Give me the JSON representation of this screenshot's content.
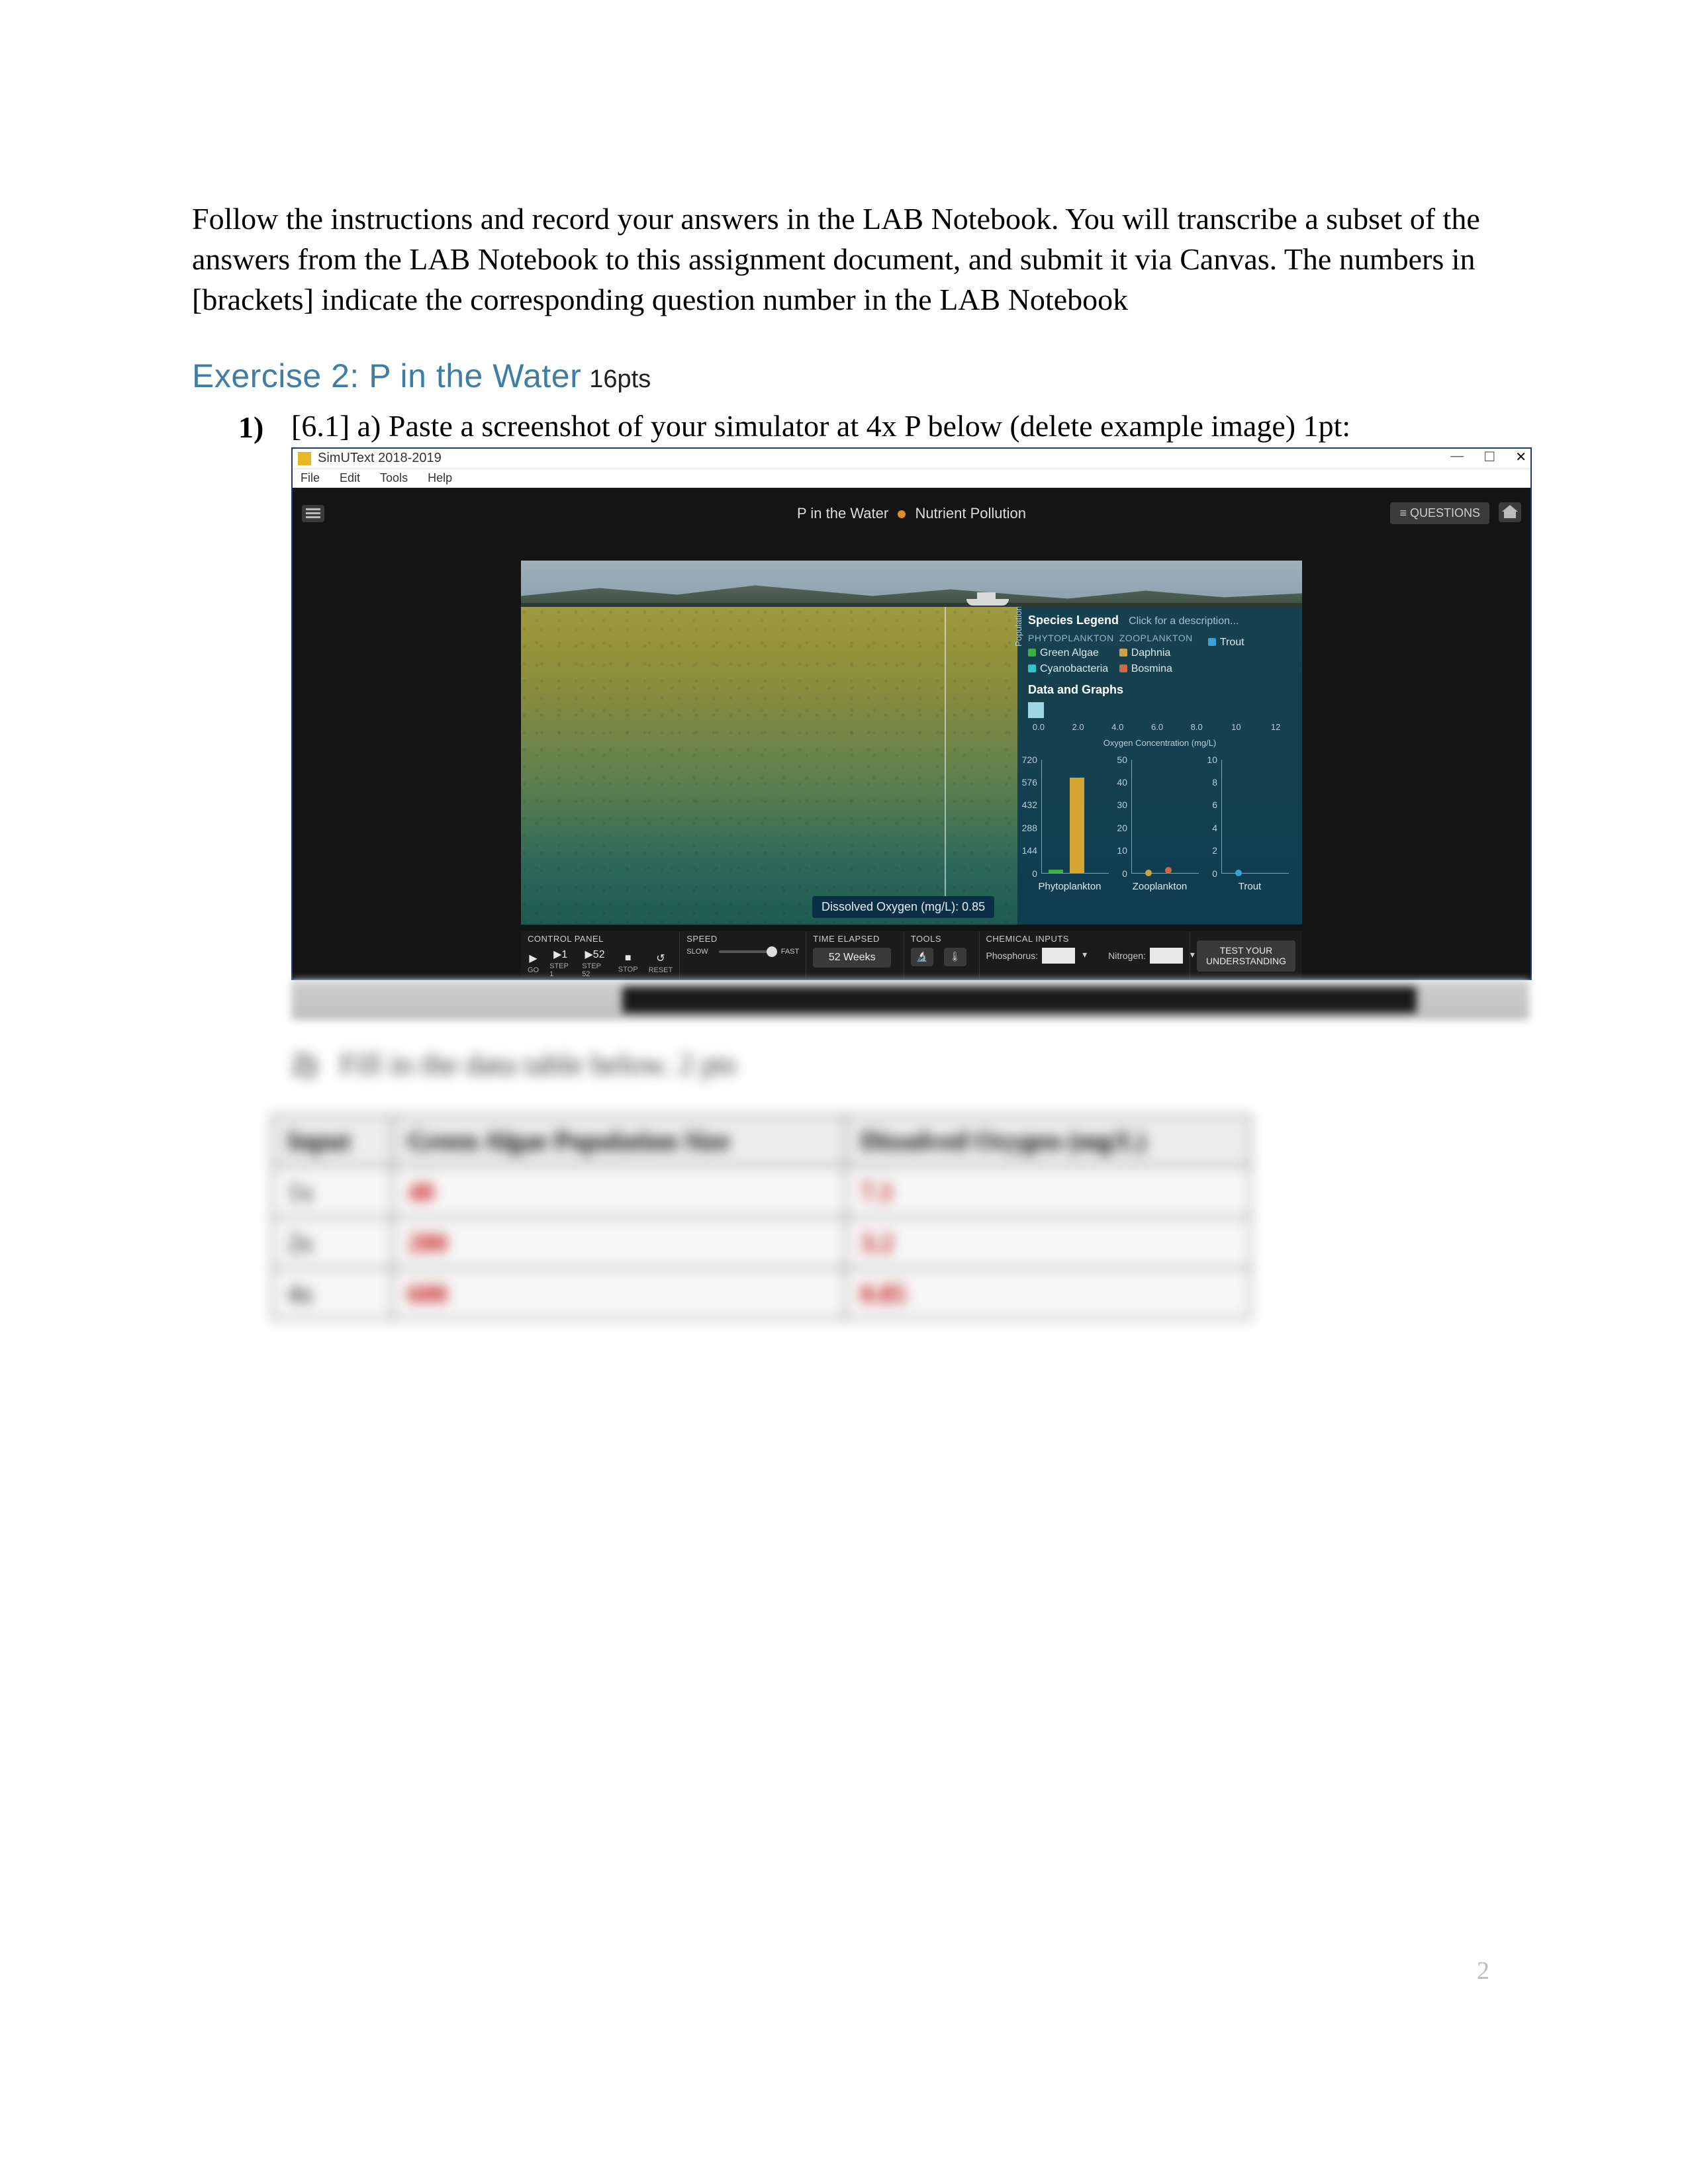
{
  "intro": "Follow the instructions and record your answers in the LAB Notebook. You will transcribe a subset of the answers from the LAB Notebook to this assignment document, and submit it via Canvas. The numbers in [brackets] indicate the corresponding question number in the LAB Notebook",
  "exercise": {
    "title": "Exercise 2: P in the Water",
    "points": "16pts"
  },
  "q1": {
    "num": "1)",
    "text": "[6.1] a) Paste a screenshot of your simulator at 4x P below (delete example image) 1pt:"
  },
  "sim": {
    "window_title": "SimUText 2018-2019",
    "menus": [
      "File",
      "Edit",
      "Tools",
      "Help"
    ],
    "win_buttons": {
      "min": "—",
      "max": "☐",
      "close": "✕"
    },
    "topbar": {
      "title_left": "P in the Water",
      "title_right": "Nutrient Pollution",
      "questions_btn": "≡ QUESTIONS"
    },
    "side_panel": {
      "legend_title": "Species Legend",
      "legend_sub": "Click for a description...",
      "col_headers": [
        "PHYTOPLANKTON",
        "ZOOPLANKTON",
        ""
      ],
      "species": {
        "phyto": [
          "Green Algae",
          "Cyanobacteria"
        ],
        "zoo": [
          "Daphnia",
          "Bosmina"
        ],
        "fish": [
          "Trout"
        ]
      },
      "data_graphs_title": "Data and Graphs",
      "oxy_axis_label": "Oxygen Concentration (mg/L)"
    },
    "do_readout": "Dissolved Oxygen (mg/L): 0.85",
    "controls": {
      "panel_label": "CONTROL PANEL",
      "buttons": [
        {
          "glyph": "▶",
          "label": "GO"
        },
        {
          "glyph": "▶1",
          "label": "STEP 1"
        },
        {
          "glyph": "▶52",
          "label": "STEP 52"
        },
        {
          "glyph": "■",
          "label": "STOP"
        },
        {
          "glyph": "↺",
          "label": "RESET"
        }
      ],
      "speed_label": "SPEED",
      "speed_slow": "SLOW",
      "speed_fast": "FAST",
      "time_label": "TIME ELAPSED",
      "time_value": "52 Weeks",
      "tools_label": "TOOLS",
      "chem_label": "CHEMICAL INPUTS",
      "chem_p": "Phosphorus:",
      "chem_n": "Nitrogen:",
      "test_btn_l1": "TEST YOUR",
      "test_btn_l2": "UNDERSTANDING"
    }
  },
  "chart_data": {
    "oxygen_axis": {
      "ticks": [
        "0.0",
        "2.0",
        "4.0",
        "6.0",
        "8.0",
        "10",
        "12"
      ]
    },
    "population_size_ylabel": "Population Size",
    "charts": [
      {
        "name": "Phytoplankton",
        "type": "bar",
        "ylim": [
          0,
          720
        ],
        "yticks": [
          720,
          576,
          432,
          288,
          144
        ],
        "series": [
          {
            "name": "Green Algae",
            "value": 20,
            "color": "#3cb043"
          },
          {
            "name": "Cyanobacteria",
            "value": 600,
            "color": "#d6a531"
          }
        ]
      },
      {
        "name": "Zooplankton",
        "type": "scatter",
        "ylim": [
          0,
          50
        ],
        "yticks": [
          50,
          40,
          30,
          20,
          10
        ],
        "series": [
          {
            "name": "Daphnia",
            "value": 0,
            "color": "#c9a24a"
          },
          {
            "name": "Bosmina",
            "value": 1,
            "color": "#c96a4a"
          }
        ]
      },
      {
        "name": "Trout",
        "type": "scatter",
        "ylim": [
          0,
          10
        ],
        "yticks": [
          10,
          8,
          6,
          4,
          2
        ],
        "series": [
          {
            "name": "Trout",
            "value": 0,
            "color": "#3aa0d8"
          }
        ]
      }
    ]
  },
  "blurred": {
    "q2_num": "2)",
    "q2_text": "Fill in the data table below. 2 pts",
    "table": {
      "headers": [
        "Input",
        "Green Algae Population Size",
        "Dissolved Oxygen (mg/L)"
      ],
      "rows": [
        {
          "input": "1x",
          "algae": "40",
          "do": "7.1"
        },
        {
          "input": "2x",
          "algae": "280",
          "do": "3.2"
        },
        {
          "input": "4x",
          "algae": "600",
          "do": "0.85"
        }
      ]
    }
  },
  "page_number": "2"
}
